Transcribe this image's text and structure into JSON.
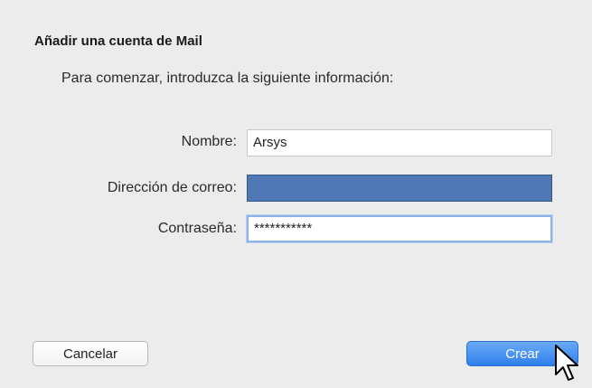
{
  "dialog": {
    "title": "Añadir una cuenta de Mail",
    "subtitle": "Para comenzar, introduzca la siguiente información:"
  },
  "form": {
    "name_label": "Nombre:",
    "name_value": "Arsys",
    "email_label": "Dirección de correo:",
    "email_value": "",
    "password_label": "Contraseña:",
    "password_value": "***********"
  },
  "buttons": {
    "cancel_label": "Cancelar",
    "create_label": "Crear"
  },
  "icons": {
    "cursor": "mouse-pointer-icon"
  },
  "colors": {
    "accent": "#2f80ec",
    "selection": "#4d78b3",
    "dialog_background": "#ececec"
  }
}
